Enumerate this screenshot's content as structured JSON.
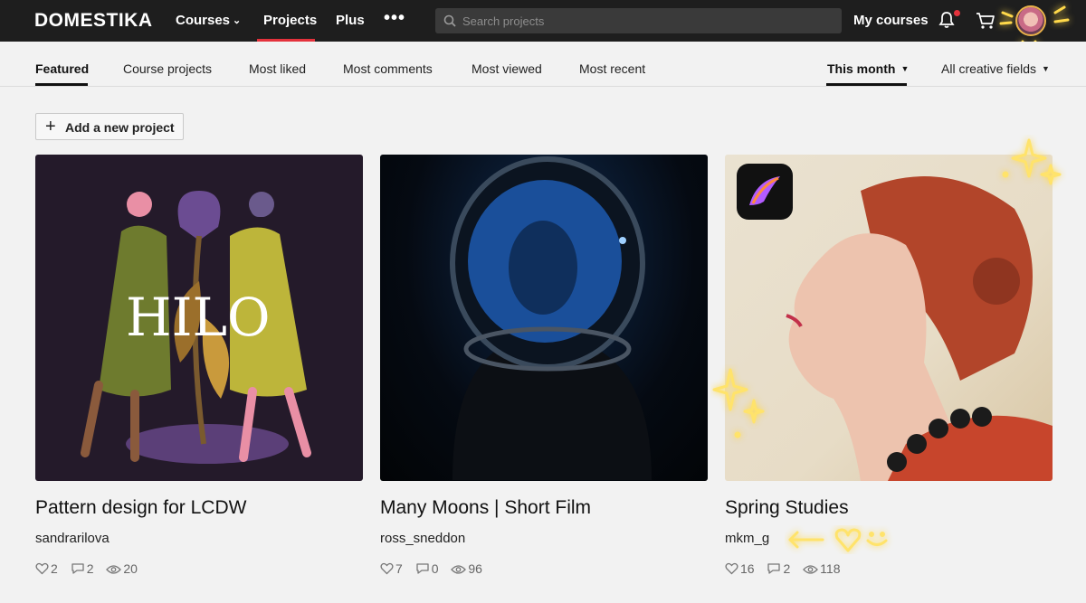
{
  "header": {
    "logo": "DOMESTIKA",
    "nav": {
      "courses": "Courses",
      "projects": "Projects",
      "plus": "Plus",
      "more": "•••"
    },
    "search_placeholder": "Search projects",
    "my_courses": "My courses"
  },
  "filters": {
    "tabs": [
      "Featured",
      "Course projects",
      "Most liked",
      "Most comments",
      "Most viewed",
      "Most recent"
    ],
    "active_tab": "Featured",
    "period": "This month",
    "field": "All creative fields"
  },
  "add_project_label": "Add a new project",
  "cards": [
    {
      "title": "Pattern design for LCDW",
      "author": "sandrarilova",
      "likes": "2",
      "comments": "2",
      "views": "20",
      "art_text": "HILO"
    },
    {
      "title": "Many Moons | Short Film",
      "author": "ross_sneddon",
      "likes": "7",
      "comments": "0",
      "views": "96"
    },
    {
      "title": "Spring Studies",
      "author": "mkm_g",
      "likes": "16",
      "comments": "2",
      "views": "118"
    }
  ],
  "colors": {
    "topbar": "#1e1e1e",
    "accent": "#e4323c",
    "page_bg": "#f2f2f2",
    "sparkle": "#ffd94a"
  }
}
